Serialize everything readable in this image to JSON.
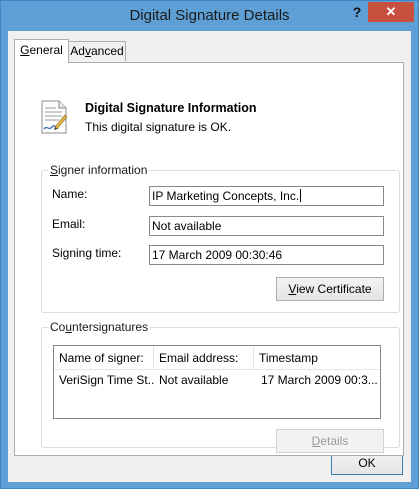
{
  "window": {
    "title": "Digital Signature Details",
    "help_label": "?",
    "close_label": "✕"
  },
  "tabs": [
    {
      "label_ul": "G",
      "label_rest": "eneral",
      "active": true
    },
    {
      "label_pre": "Ad",
      "label_ul": "v",
      "label_rest": "anced",
      "active": false
    }
  ],
  "signature": {
    "heading": "Digital Signature Information",
    "status": "This digital signature is OK."
  },
  "signer": {
    "legend_ul": "S",
    "legend_rest": "igner information",
    "name_label": "Name:",
    "name_value": "IP Marketing Concepts, Inc.",
    "email_label": "Email:",
    "email_value": "Not available",
    "time_label": "Signing time:",
    "time_value": "17 March 2009 00:30:46",
    "view_cert_ul": "V",
    "view_cert_rest": "iew Certificate"
  },
  "countersignatures": {
    "legend_pre": "Co",
    "legend_ul": "u",
    "legend_rest": "ntersignatures",
    "columns": [
      "Name of signer:",
      "Email address:",
      "Timestamp"
    ],
    "rows": [
      [
        "VeriSign Time St...",
        "Not available",
        "17 March 2009 00:3..."
      ]
    ],
    "details_ul": "D",
    "details_rest": "etails"
  },
  "footer": {
    "ok_label": "OK"
  }
}
